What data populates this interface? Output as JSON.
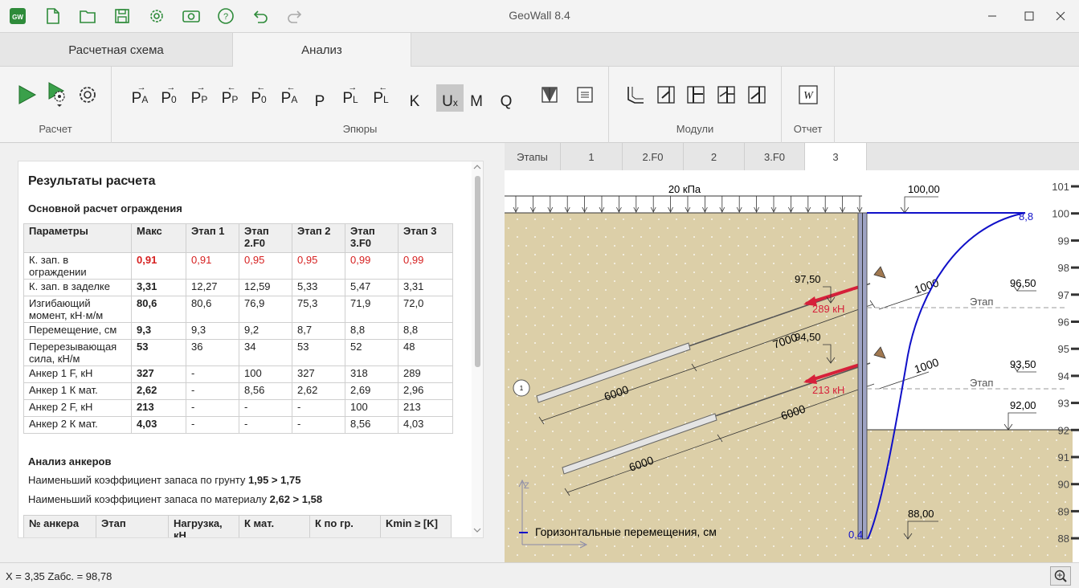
{
  "window": {
    "title": "GeoWall 8.4",
    "icons": [
      "app-logo-icon",
      "new-file-icon",
      "open-folder-icon",
      "save-icon",
      "settings-icon",
      "camera-icon",
      "help-icon",
      "undo-icon",
      "redo-icon"
    ],
    "logo_text": "GW"
  },
  "main_tabs": [
    "Расчетная схема",
    "Анализ"
  ],
  "ribbon": {
    "groups": {
      "calc": "Расчет",
      "diagrams": "Эпюры",
      "modules": "Модули",
      "report": "Отчет"
    },
    "diagram_buttons": [
      {
        "l": "P",
        "s": "A",
        "a": "→"
      },
      {
        "l": "P",
        "s": "0",
        "a": "→"
      },
      {
        "l": "P",
        "s": "P",
        "a": "→"
      },
      {
        "l": "P",
        "s": "P",
        "a": "←"
      },
      {
        "l": "P",
        "s": "0",
        "a": "←"
      },
      {
        "l": "P",
        "s": "A",
        "a": "←"
      },
      {
        "l": "P",
        "s": "",
        "a": ""
      },
      {
        "l": "P",
        "s": "L",
        "a": "→"
      },
      {
        "l": "P",
        "s": "L",
        "a": "←"
      },
      {
        "l": "K",
        "s": "",
        "a": ""
      },
      {
        "l": "U",
        "s": "x",
        "a": ""
      },
      {
        "l": "M",
        "s": "",
        "a": ""
      },
      {
        "l": "Q",
        "s": "",
        "a": ""
      }
    ],
    "report_btn": "W"
  },
  "report": {
    "title": "Результаты расчета",
    "section_main": "Основной расчет ограждения",
    "headers": [
      "Параметры",
      "Макс",
      "Этап 1",
      "Этап 2.F0",
      "Этап 2",
      "Этап 3.F0",
      "Этап 3"
    ],
    "rows": [
      [
        "К. зап. в ограждении",
        "0,91",
        "0,91",
        "0,95",
        "0,95",
        "0,99",
        "0,99"
      ],
      [
        "К. зап. в заделке",
        "3,31",
        "12,27",
        "12,59",
        "5,33",
        "5,47",
        "3,31"
      ],
      [
        "Изгибающий момент, кН·м/м",
        "80,6",
        "80,6",
        "76,9",
        "75,3",
        "71,9",
        "72,0"
      ],
      [
        "Перемещение, см",
        "9,3",
        "9,3",
        "9,2",
        "8,7",
        "8,8",
        "8,8"
      ],
      [
        "Перерезывающая сила, кН/м",
        "53",
        "36",
        "34",
        "53",
        "52",
        "48"
      ],
      [
        "Анкер 1 F, кН",
        "327",
        "-",
        "100",
        "327",
        "318",
        "289"
      ],
      [
        "Анкер 1 К мат.",
        "2,62",
        "-",
        "8,56",
        "2,62",
        "2,69",
        "2,96"
      ],
      [
        "Анкер 2 F, кН",
        "213",
        "-",
        "-",
        "-",
        "100",
        "213"
      ],
      [
        "Анкер 2 К мат.",
        "4,03",
        "-",
        "-",
        "-",
        "8,56",
        "4,03"
      ]
    ],
    "section_anchors": "Анализ анкеров",
    "soil_label": "Наименьший коэффициент запаса по грунту ",
    "soil_value": "1,95 > 1,75",
    "mat_label": "Наименьший коэффициент запаса по материалу ",
    "mat_value": "2,62 > 1,58",
    "anchor_headers": [
      "№ анкера",
      "Этап",
      "Нагрузка, кН",
      "К мат.",
      "К по гр.",
      "Kmin ≥ [K]"
    ]
  },
  "stages": [
    "Этапы",
    "1",
    "2.F0",
    "2",
    "3.F0",
    "3"
  ],
  "drawing": {
    "load": "20 кПа",
    "levels_marked": [
      "100,00",
      "97,50",
      "96,50",
      "94,50",
      "93,50",
      "92,00",
      "88,00"
    ],
    "stage_label": "Этап",
    "anchor1_force": "289 кН",
    "anchor2_force": "213 кН",
    "dims": [
      "1000",
      "7000",
      "6000",
      "1000",
      "6000",
      "6000"
    ],
    "disp_top": "8,8",
    "disp_bottom": "0,4",
    "legend": "Горизонтальные перемещения, см",
    "axis_z": "Z",
    "anchor_num": "1",
    "scale": [
      "101",
      "100",
      "99",
      "98",
      "97",
      "96",
      "95",
      "94",
      "93",
      "92",
      "91",
      "90",
      "89",
      "88"
    ],
    "colors": {
      "soil": "#dccfa8",
      "force": "#d6203a",
      "disp": "#1010c8",
      "wall": "#7a7fa8"
    }
  },
  "status": {
    "coords": "X = 3,35  Zабс. = 98,78"
  }
}
